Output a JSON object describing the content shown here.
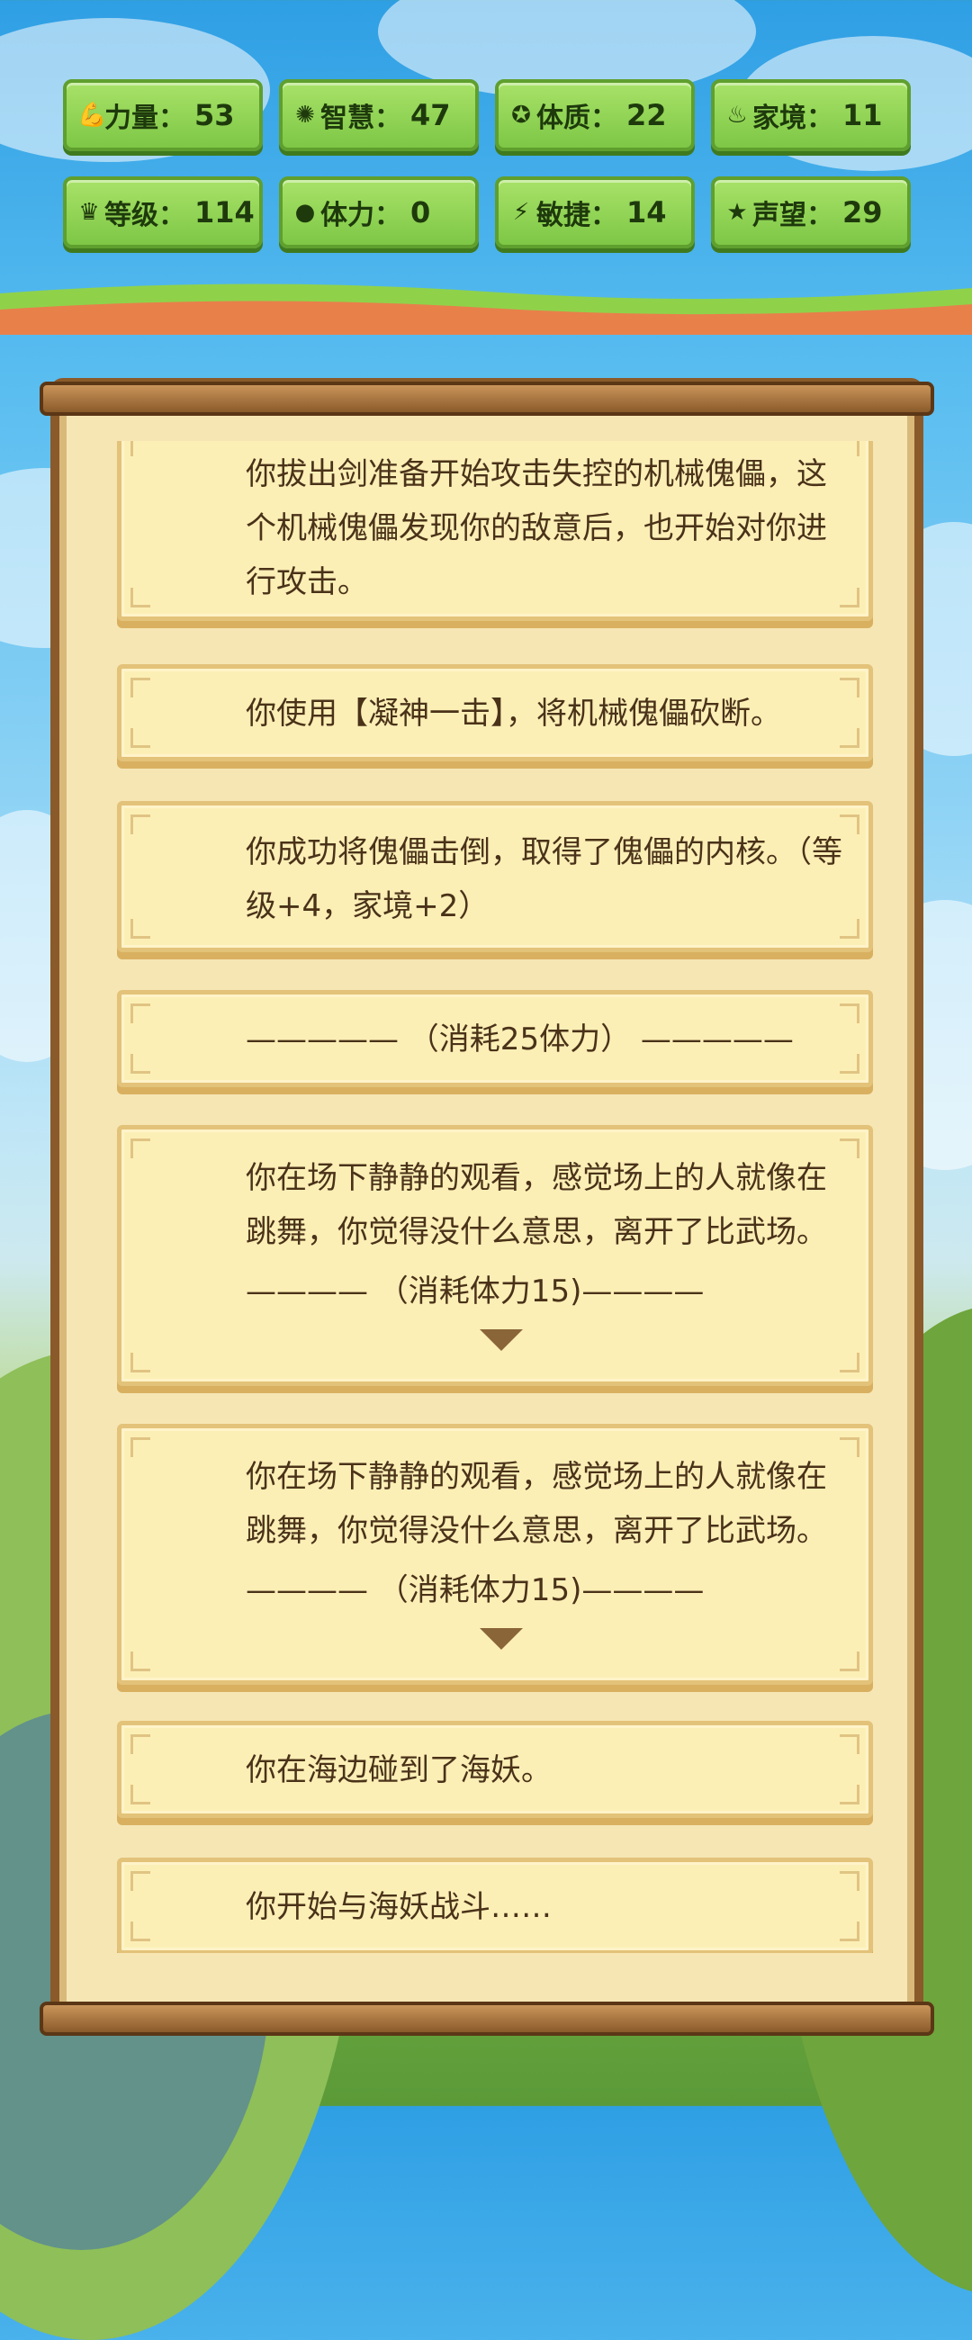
{
  "stats": [
    {
      "icon": "strength-icon",
      "glyph": "💪",
      "label": "力量：",
      "value": "53"
    },
    {
      "icon": "wisdom-icon",
      "glyph": "✺",
      "label": "智慧：",
      "value": "47"
    },
    {
      "icon": "constitution-icon",
      "glyph": "✪",
      "label": "体质：",
      "value": "22"
    },
    {
      "icon": "family-icon",
      "glyph": "♨",
      "label": "家境：",
      "value": "11"
    },
    {
      "icon": "crown-icon",
      "glyph": "♛",
      "label": "等级：",
      "value": "114"
    },
    {
      "icon": "stamina-icon",
      "glyph": "●",
      "label": "体力：",
      "value": "0"
    },
    {
      "icon": "lightning-icon",
      "glyph": "⚡",
      "label": "敏捷：",
      "value": "14"
    },
    {
      "icon": "star-icon",
      "glyph": "★",
      "label": "声望：",
      "value": "29"
    }
  ],
  "log": [
    {
      "text": "你拔出剑准备开始攻击失控的机械傀儡，这个机械傀儡发现你的敌意后，也开始对你进行攻击。"
    },
    {
      "text": "你使用【凝神一击】，将机械傀儡砍断。"
    },
    {
      "text": "你成功将傀儡击倒，取得了傀儡的内核。（等级+4，家境+2）"
    },
    {
      "text": "————— （消耗25体力） —————"
    },
    {
      "text": "你在场下静静的观看，感觉场上的人就像在跳舞，你觉得没什么意思，离开了比武场。",
      "cost": "———— （消耗体力15)————"
    },
    {
      "text": "你在场下静静的观看，感觉场上的人就像在跳舞，你觉得没什么意思，离开了比武场。",
      "cost": "———— （消耗体力15)————"
    },
    {
      "text": "你在海边碰到了海妖。"
    },
    {
      "text": "你开始与海妖战斗……"
    }
  ]
}
